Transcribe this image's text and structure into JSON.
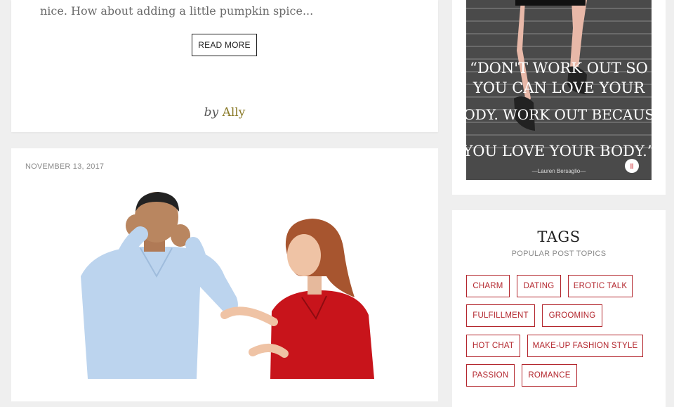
{
  "previous_post": {
    "excerpt": "nice. How about adding a little pumpkin spice...",
    "read_more_label": "READ MORE",
    "byline_prefix": "by",
    "author": "Ally"
  },
  "post": {
    "date": "NOVEMBER 13, 2017",
    "image_alt": "man covering ears while woman talks"
  },
  "sidebar": {
    "quote_image": {
      "lines": [
        "“DON'T WORK OUT SO",
        "YOU CAN LOVE YOUR",
        "BODY. WORK OUT BECAUSE",
        "YOU LOVE YOUR BODY.”"
      ],
      "attribution": "—Lauren Bersaglio—",
      "logo": "ll"
    },
    "tags_widget": {
      "title": "TAGS",
      "subtitle": "POPULAR POST TOPICS",
      "tags": [
        "CHARM",
        "DATING",
        "EROTIC TALK",
        "FULFILLMENT",
        "GROOMING",
        "HOT CHAT",
        "MAKE-UP FASHION STYLE",
        "PASSION",
        "ROMANCE"
      ]
    }
  },
  "colors": {
    "background": "#efefef",
    "card": "#ffffff",
    "tag_accent": "#b3262d",
    "author_link": "#8a7a28"
  }
}
